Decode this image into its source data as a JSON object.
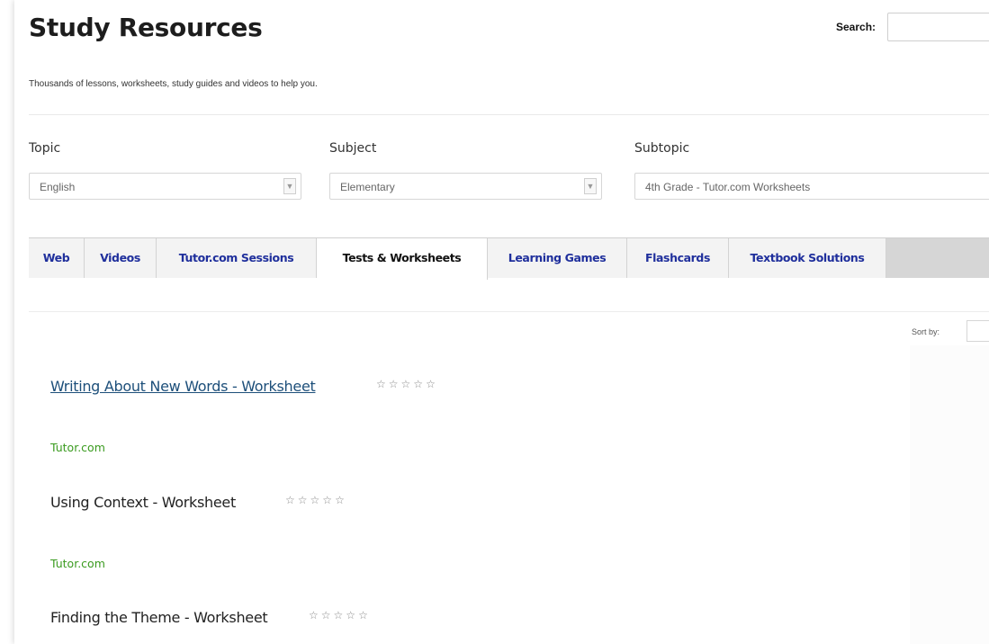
{
  "header": {
    "title": "Study Resources",
    "search_label": "Search:",
    "search_value": "",
    "tagline": "Thousands of lessons, worksheets, study guides and videos to help you."
  },
  "filters": {
    "topic": {
      "label": "Topic",
      "value": "English"
    },
    "subject": {
      "label": "Subject",
      "value": "Elementary"
    },
    "subtopic": {
      "label": "Subtopic",
      "value": "4th Grade - Tutor.com Worksheets"
    }
  },
  "tabs": [
    {
      "label": "Web"
    },
    {
      "label": "Videos"
    },
    {
      "label": "Tutor.com Sessions"
    },
    {
      "label": "Tests & Worksheets",
      "active": true
    },
    {
      "label": "Learning Games"
    },
    {
      "label": "Flashcards"
    },
    {
      "label": "Textbook Solutions"
    }
  ],
  "sort": {
    "label": "Sort by:"
  },
  "results": [
    {
      "title": "Writing About New Words - Worksheet",
      "rating": 0,
      "max_rating": 5,
      "source": "Tutor.com",
      "is_link": true
    },
    {
      "title": "Using Context - Worksheet",
      "rating": 0,
      "max_rating": 5,
      "source": "Tutor.com",
      "is_link": false
    },
    {
      "title": "Finding the Theme - Worksheet",
      "rating": 0,
      "max_rating": 5,
      "is_link": false
    }
  ],
  "colors": {
    "tab_link": "#1f2f9c",
    "source_green": "#3a9b1f",
    "result_link": "#1d4f7a"
  },
  "icons": {
    "star": "star-outline-icon",
    "dropdown": "chevron-down-icon"
  }
}
